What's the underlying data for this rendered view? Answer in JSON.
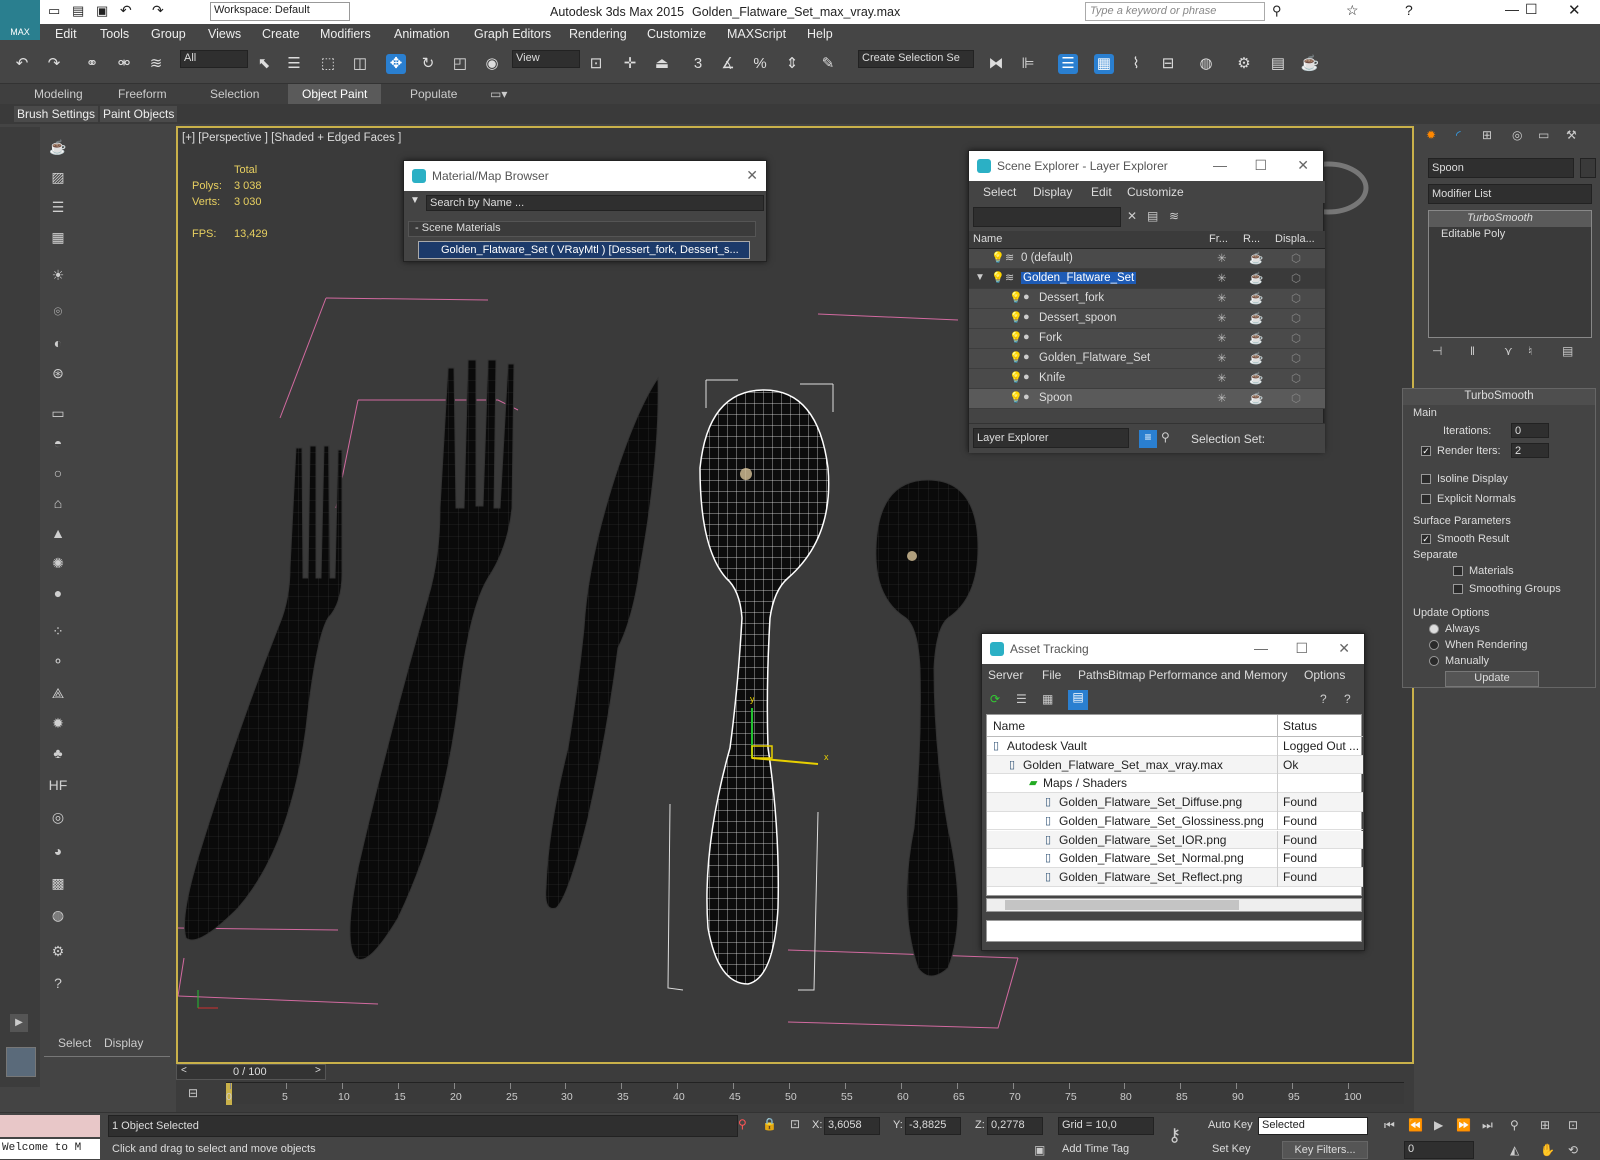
{
  "title": {
    "app": "Autodesk 3ds Max  2015",
    "file": "Golden_Flatware_Set_max_vray.max",
    "workspace": "Workspace: Default",
    "search_placeholder": "Type a keyword or phrase"
  },
  "menu": [
    "Edit",
    "Tools",
    "Group",
    "Views",
    "Create",
    "Modifiers",
    "Animation",
    "Graph Editors",
    "Rendering",
    "Customize",
    "MAXScript",
    "Help"
  ],
  "toolbar": {
    "filter": "All",
    "view": "View",
    "selection_set": "Create Selection Se"
  },
  "ribbon": {
    "tabs": [
      "Modeling",
      "Freeform",
      "Selection",
      "Object Paint",
      "Populate"
    ],
    "sub": [
      "Brush Settings",
      "Paint Objects"
    ]
  },
  "viewport": {
    "label": "[+] [Perspective ] [Shaded + Edged Faces ]",
    "stats_header": "Total",
    "polys_label": "Polys:",
    "polys": "3 038",
    "verts_label": "Verts:",
    "verts": "3 030",
    "fps_label": "FPS:",
    "fps": "13,429"
  },
  "material_browser": {
    "title": "Material/Map Browser",
    "search": "Search by Name ...",
    "group": "Scene Materials",
    "item": "Golden_Flatware_Set  ( VRayMtl ) [Dessert_fork, Dessert_s..."
  },
  "scene_explorer": {
    "title": "Scene Explorer - Layer Explorer",
    "menu": [
      "Select",
      "Display",
      "Edit",
      "Customize"
    ],
    "cols": [
      "Name",
      "Fr...",
      "R...",
      "Displa..."
    ],
    "rows": [
      {
        "name": "0 (default)",
        "indent": 0
      },
      {
        "name": "Golden_Flatware_Set",
        "indent": 0
      },
      {
        "name": "Dessert_fork",
        "indent": 1
      },
      {
        "name": "Dessert_spoon",
        "indent": 1
      },
      {
        "name": "Fork",
        "indent": 1
      },
      {
        "name": "Golden_Flatware_Set",
        "indent": 1
      },
      {
        "name": "Knife",
        "indent": 1
      },
      {
        "name": "Spoon",
        "indent": 1
      }
    ],
    "footer": "Layer Explorer",
    "selection_set": "Selection Set:"
  },
  "asset_tracking": {
    "title": "Asset Tracking",
    "menu": [
      "Server",
      "File",
      "Paths",
      "Bitmap Performance and Memory",
      "Options"
    ],
    "cols": [
      "Name",
      "Status"
    ],
    "rows": [
      {
        "name": "Autodesk Vault",
        "status": "Logged Out ..."
      },
      {
        "name": "Golden_Flatware_Set_max_vray.max",
        "status": "Ok"
      },
      {
        "name": "Maps / Shaders",
        "status": ""
      },
      {
        "name": "Golden_Flatware_Set_Diffuse.png",
        "status": "Found"
      },
      {
        "name": "Golden_Flatware_Set_Glossiness.png",
        "status": "Found"
      },
      {
        "name": "Golden_Flatware_Set_IOR.png",
        "status": "Found"
      },
      {
        "name": "Golden_Flatware_Set_Normal.png",
        "status": "Found"
      },
      {
        "name": "Golden_Flatware_Set_Reflect.png",
        "status": "Found"
      }
    ]
  },
  "command_panel": {
    "object_name": "Spoon",
    "modifier_list": "Modifier List",
    "stack": [
      "TurboSmooth",
      "Editable Poly"
    ],
    "rollout": "TurboSmooth",
    "main": "Main",
    "iterations_label": "Iterations:",
    "iterations": "0",
    "render_iters_label": "Render Iters:",
    "render_iters": "2",
    "isoline": "Isoline Display",
    "explicit": "Explicit Normals",
    "surface": "Surface Parameters",
    "smooth_result": "Smooth Result",
    "separate": "Separate",
    "materials": "Materials",
    "smoothing_groups": "Smoothing Groups",
    "update_options": "Update Options",
    "always": "Always",
    "when_rendering": "When Rendering",
    "manually": "Manually",
    "update_btn": "Update"
  },
  "left_panel": {
    "select": "Select",
    "display": "Display"
  },
  "timeline": {
    "frame": "0 / 100",
    "ticks": [
      "0",
      "5",
      "10",
      "15",
      "20",
      "25",
      "30",
      "35",
      "40",
      "45",
      "50",
      "55",
      "60",
      "65",
      "70",
      "75",
      "80",
      "85",
      "90",
      "95",
      "100"
    ]
  },
  "status": {
    "welcome": "Welcome to M",
    "selected": "1 Object Selected",
    "prompt": "Click and drag to select and move objects",
    "x_label": "X:",
    "x": "3,6058",
    "y_label": "Y:",
    "y": "-3,8825",
    "z_label": "Z:",
    "z": "0,2778",
    "grid": "Grid = 10,0",
    "auto_key": "Auto Key",
    "set_key": "Set Key",
    "key_mode": "Selected",
    "key_filters": "Key Filters...",
    "add_time_tag": "Add Time Tag",
    "frame": "0"
  }
}
